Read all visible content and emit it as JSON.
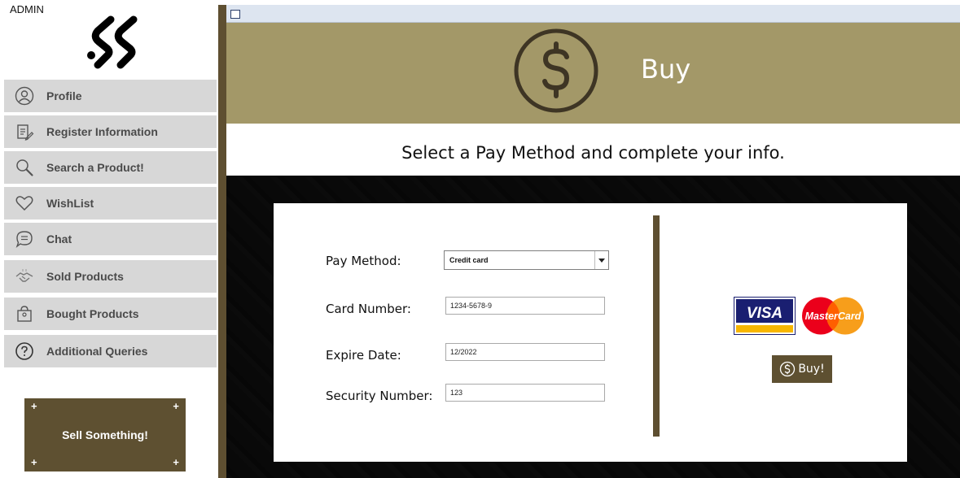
{
  "app": {
    "user_label": "ADMIN"
  },
  "sidebar": {
    "items": [
      {
        "label": "Profile",
        "icon": "user-icon"
      },
      {
        "label": "Register Information",
        "icon": "document-edit-icon"
      },
      {
        "label": "Search a Product!",
        "icon": "search-icon"
      },
      {
        "label": "WishList",
        "icon": "heart-icon"
      },
      {
        "label": "Chat",
        "icon": "chat-icon"
      },
      {
        "label": "Sold Products",
        "icon": "handshake-icon"
      },
      {
        "label": "Bought Products",
        "icon": "shopping-bag-icon"
      },
      {
        "label": "Additional Queries",
        "icon": "question-icon"
      }
    ],
    "sell_button": "Sell Something!"
  },
  "header": {
    "title": "Buy",
    "icon": "dollar-icon"
  },
  "subtitle": "Select a Pay Method and complete your info.",
  "form": {
    "pay_method_label": "Pay Method:",
    "pay_method_value": "Credit card",
    "card_number_label": "Card Number:",
    "card_number_value": "1234-5678-9",
    "expire_date_label": "Expire Date:",
    "expire_date_value": "12/2022",
    "security_number_label": "Security Number:",
    "security_number_value": "123"
  },
  "cards": {
    "visa_text": "VISA",
    "mastercard_text": "MasterCard"
  },
  "buy_button": "Buy!",
  "colors": {
    "brand_dark": "#5e5031",
    "header_bg": "#a39868",
    "nav_bg": "#d7d7d7",
    "visa_blue": "#1a1f71",
    "visa_gold": "#f7b600",
    "mc_red": "#eb001b",
    "mc_orange": "#f79e1b"
  }
}
